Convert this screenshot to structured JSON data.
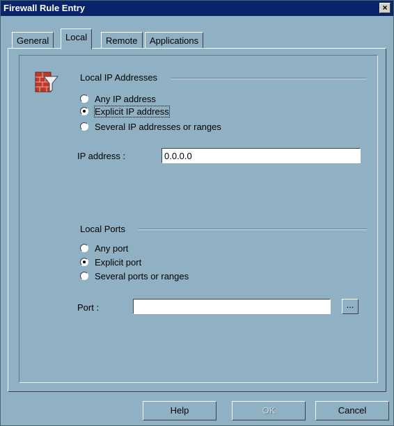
{
  "window": {
    "title": "Firewall Rule Entry",
    "close_label": "×"
  },
  "tabs": [
    {
      "label": "General"
    },
    {
      "label": "Local"
    },
    {
      "label": "Remote"
    },
    {
      "label": "Applications"
    }
  ],
  "local_ip": {
    "group_label": "Local IP Addresses",
    "options": [
      {
        "label": "Any IP address",
        "selected": false
      },
      {
        "label": "Explicit IP address",
        "selected": true
      },
      {
        "label": "Several IP addresses or ranges",
        "selected": false
      }
    ],
    "field_label": "IP address :",
    "field_value": "0.0.0.0"
  },
  "local_ports": {
    "group_label": "Local Ports",
    "options": [
      {
        "label": "Any port",
        "selected": false
      },
      {
        "label": "Explicit port",
        "selected": true
      },
      {
        "label": "Several ports or ranges",
        "selected": false
      }
    ],
    "field_label": "Port :",
    "field_value": "",
    "browse_label": "..."
  },
  "buttons": {
    "help": "Help",
    "ok": "OK",
    "cancel": "Cancel"
  },
  "icons": {
    "rule_icon": "firewall-filter-icon"
  }
}
